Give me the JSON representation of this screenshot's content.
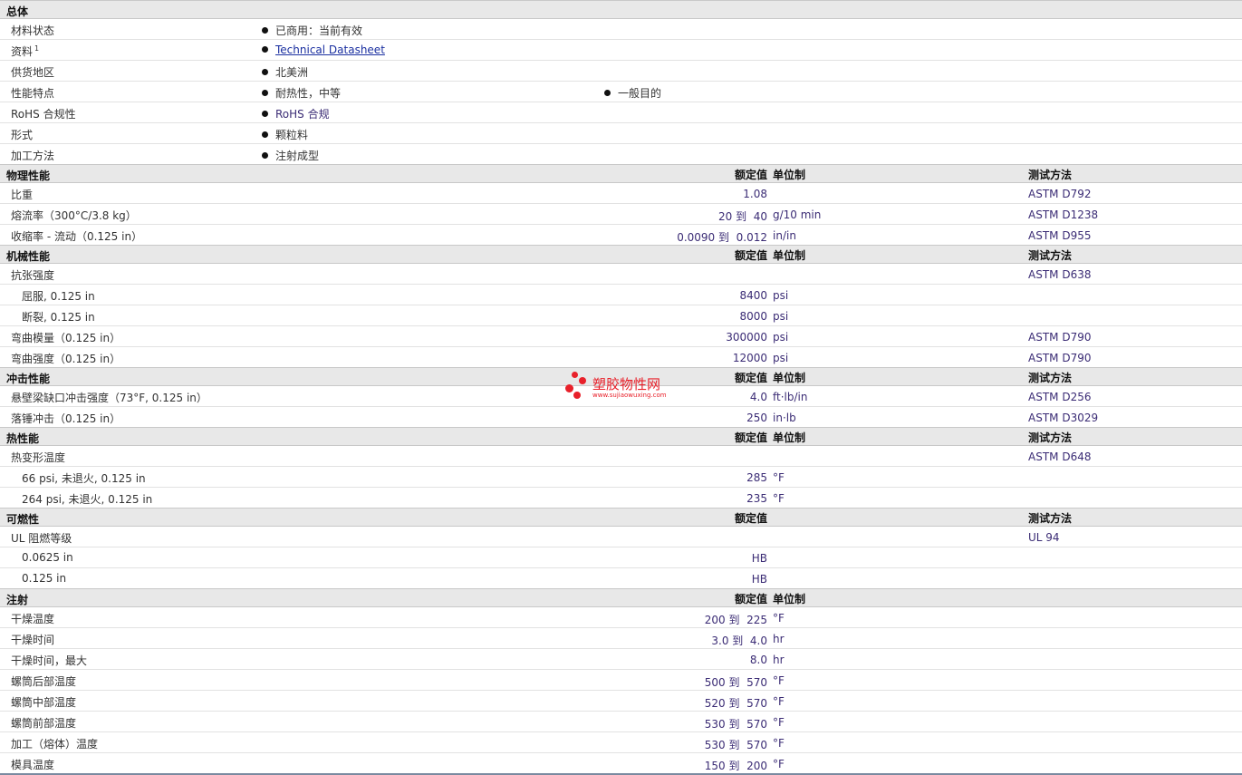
{
  "headers": {
    "rated": "额定值",
    "unit": "单位制",
    "test": "测试方法"
  },
  "general": {
    "title": "总体",
    "rows": [
      {
        "label": "材料状态",
        "v1": "已商用：当前有效"
      },
      {
        "label": "资料",
        "sup": "1",
        "v1": "Technical Datasheet"
      },
      {
        "label": "供货地区",
        "v1": "北美洲"
      },
      {
        "label": "性能特点",
        "v1": "耐热性，中等",
        "v2": "一般目的"
      },
      {
        "label": "RoHS 合规性",
        "v1": "RoHS 合规"
      },
      {
        "label": "形式",
        "v1": "颗粒料"
      },
      {
        "label": "加工方法",
        "v1": "注射成型"
      }
    ]
  },
  "physical": {
    "title": "物理性能",
    "rows": [
      {
        "label": "比重",
        "value": "1.08",
        "unit": "",
        "test": "ASTM D792"
      },
      {
        "label": "熔流率（300°C/3.8 kg）",
        "value": "20 到  40",
        "unit": "g/10 min",
        "test": "ASTM D1238"
      },
      {
        "label": "收缩率 - 流动（0.125 in）",
        "value": "0.0090 到  0.012",
        "unit": "in/in",
        "test": "ASTM D955"
      }
    ]
  },
  "mechanical": {
    "title": "机械性能",
    "rows": [
      {
        "label": "抗张强度",
        "value": "",
        "unit": "",
        "test": "ASTM D638"
      },
      {
        "label": "屈服, 0.125 in",
        "value": "8400",
        "unit": "psi",
        "test": ""
      },
      {
        "label": "断裂, 0.125 in",
        "value": "8000",
        "unit": "psi",
        "test": ""
      },
      {
        "label": "弯曲模量（0.125 in）",
        "value": "300000",
        "unit": "psi",
        "test": "ASTM D790"
      },
      {
        "label": "弯曲强度（0.125 in）",
        "value": "12000",
        "unit": "psi",
        "test": "ASTM D790"
      }
    ]
  },
  "impact": {
    "title": "冲击性能",
    "rows": [
      {
        "label": "悬壁梁缺口冲击强度（73°F, 0.125 in）",
        "value": "4.0",
        "unit": "ft·lb/in",
        "test": "ASTM D256"
      },
      {
        "label": "落锤冲击（0.125 in）",
        "value": "250",
        "unit": "in·lb",
        "test": "ASTM D3029"
      }
    ]
  },
  "thermal": {
    "title": "热性能",
    "rows": [
      {
        "label": "热变形温度",
        "value": "",
        "unit": "",
        "test": "ASTM D648"
      },
      {
        "label": "66 psi, 未退火, 0.125 in",
        "value": "285",
        "unit": "°F",
        "test": ""
      },
      {
        "label": "264 psi, 未退火, 0.125 in",
        "value": "235",
        "unit": "°F",
        "test": ""
      }
    ]
  },
  "flammability": {
    "title": "可燃性",
    "rows": [
      {
        "label": "UL 阻燃等级",
        "value": "",
        "unit": "",
        "test": "UL 94"
      },
      {
        "label": "0.0625 in",
        "value": "HB",
        "unit": "",
        "test": ""
      },
      {
        "label": "0.125 in",
        "value": "HB",
        "unit": "",
        "test": ""
      }
    ]
  },
  "injection": {
    "title": "注射",
    "rows": [
      {
        "label": "干燥温度",
        "value": "200 到  225",
        "unit": "°F"
      },
      {
        "label": "干燥时间",
        "value": "3.0 到  4.0",
        "unit": "hr"
      },
      {
        "label": "干燥时间，最大",
        "value": "8.0",
        "unit": "hr"
      },
      {
        "label": "螺筒后部温度",
        "value": "500 到  570",
        "unit": "°F"
      },
      {
        "label": "螺筒中部温度",
        "value": "520 到  570",
        "unit": "°F"
      },
      {
        "label": "螺筒前部温度",
        "value": "530 到  570",
        "unit": "°F"
      },
      {
        "label": "加工（熔体）温度",
        "value": "530 到  570",
        "unit": "°F"
      },
      {
        "label": "模具温度",
        "value": "150 到  200",
        "unit": "°F"
      }
    ]
  },
  "watermark": {
    "title": "塑胶物性网",
    "url": "www.sujiaowuxing.com"
  }
}
